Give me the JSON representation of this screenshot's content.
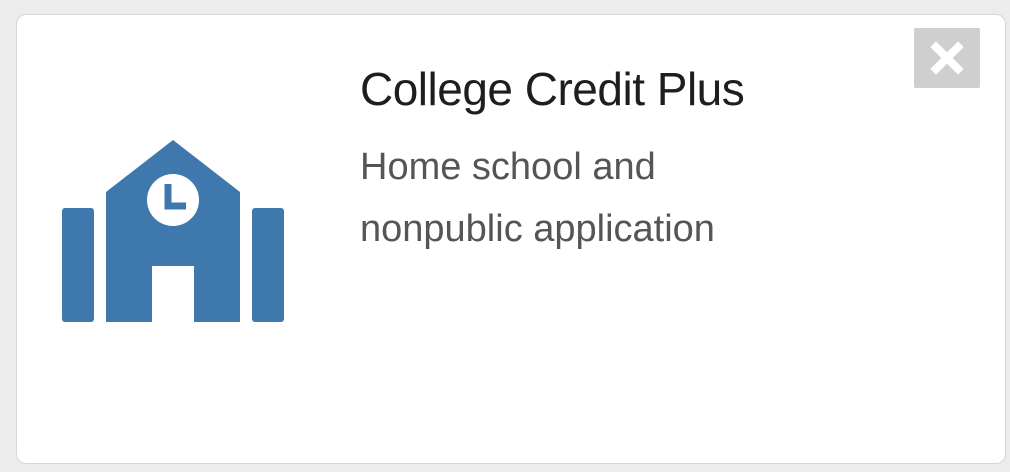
{
  "card": {
    "title": "College Credit Plus",
    "description_lines": [
      "Home school and",
      "nonpublic application"
    ],
    "icon": "school-building-icon",
    "close_icon": "close-icon"
  },
  "colors": {
    "icon": "#3e78ac",
    "close_bg": "#cfcfcf",
    "title": "#1e1e1e",
    "description": "#555555"
  }
}
